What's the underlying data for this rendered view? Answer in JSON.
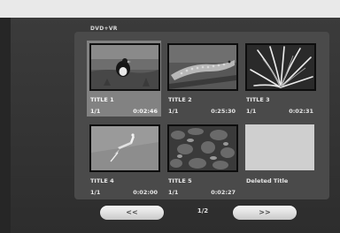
{
  "menu": {
    "header": "DVD+VR"
  },
  "titles": [
    {
      "title": "TITLE 1",
      "counter": "1/1",
      "duration": "0:02:46",
      "thumbnail": "bird-on-grass-icon",
      "selected": true
    },
    {
      "title": "TITLE 2",
      "counter": "1/1",
      "duration": "0:25:30",
      "thumbnail": "lizard-on-branch-icon",
      "selected": false
    },
    {
      "title": "TITLE 3",
      "counter": "1/1",
      "duration": "0:02:31",
      "thumbnail": "spiky-plant-icon",
      "selected": false
    },
    {
      "title": "TITLE 4",
      "counter": "1/1",
      "duration": "0:02:00",
      "thumbnail": "bird-in-flight-icon",
      "selected": false
    },
    {
      "title": "TITLE 5",
      "counter": "1/1",
      "duration": "0:02:27",
      "thumbnail": "foliage-icon",
      "selected": false
    },
    {
      "title": "Deleted Title",
      "counter": "",
      "duration": "",
      "thumbnail": "",
      "selected": false
    }
  ],
  "pager": {
    "prev_label": "<<",
    "page": "1/2",
    "next_label": ">>"
  }
}
